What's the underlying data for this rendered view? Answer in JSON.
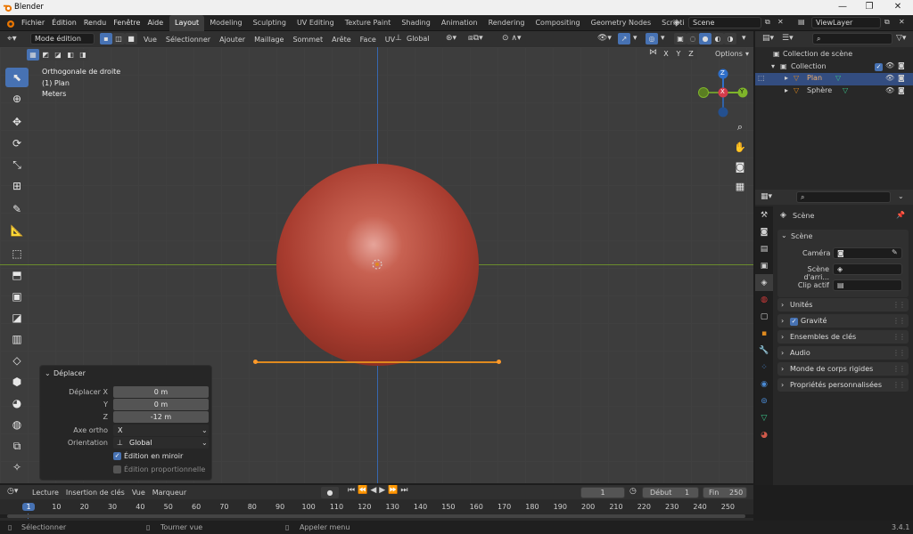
{
  "window": {
    "title": "Blender",
    "minimize": "—",
    "maximize": "❐",
    "close": "✕"
  },
  "menu": [
    "Fichier",
    "Édition",
    "Rendu",
    "Fenêtre",
    "Aide"
  ],
  "workspaces": [
    "Layout",
    "Modeling",
    "Sculpting",
    "UV Editing",
    "Texture Paint",
    "Shading",
    "Animation",
    "Rendering",
    "Compositing",
    "Geometry Nodes",
    "Scripting"
  ],
  "scene": {
    "name": "Scene",
    "viewlayer": "ViewLayer"
  },
  "header": {
    "mode": "Mode édition",
    "items": [
      "Vue",
      "Sélectionner",
      "Ajouter",
      "Maillage",
      "Sommet",
      "Arête",
      "Face",
      "UV"
    ],
    "orientation": "Global",
    "options": "Options",
    "axes": [
      "X",
      "Y",
      "Z"
    ]
  },
  "viewport": {
    "view_name": "Orthogonale de droite",
    "object": "(1) Plan",
    "units": "Meters",
    "gizmo": {
      "x": "X",
      "y": "Y",
      "z": "Z"
    }
  },
  "operator": {
    "title": "Déplacer",
    "move_label": "Déplacer X",
    "x": "0 m",
    "y_label": "Y",
    "y": "0 m",
    "z_label": "Z",
    "z": "-12 m",
    "axis_label": "Axe ortho",
    "axis": "X",
    "orient_label": "Orientation",
    "orient": "Global",
    "mirror": "Édition en miroir",
    "proportional": "Édition proportionnelle"
  },
  "outliner": {
    "root": "Collection de scène",
    "collection": "Collection",
    "items": [
      {
        "name": "Plan"
      },
      {
        "name": "Sphère"
      }
    ]
  },
  "properties": {
    "context": "Scène",
    "section": "Scène",
    "camera_label": "Caméra",
    "background_label": "Scène d'arri...",
    "clip_label": "Clip actif",
    "panels": [
      "Unités",
      "Gravité",
      "Ensembles de clés",
      "Audio",
      "Monde de corps rigides",
      "Propriétés personnalisées"
    ]
  },
  "timeline": {
    "menus": [
      "Lecture",
      "Insertion de clés",
      "Vue",
      "Marqueur"
    ],
    "current_frame": "1",
    "start_label": "Début",
    "start": "1",
    "end_label": "Fin",
    "end": "250",
    "ticks": [
      "1",
      "10",
      "20",
      "30",
      "40",
      "50",
      "60",
      "70",
      "80",
      "90",
      "100",
      "110",
      "120",
      "130",
      "140",
      "150",
      "160",
      "170",
      "180",
      "190",
      "200",
      "210",
      "220",
      "230",
      "240",
      "250"
    ]
  },
  "status": {
    "select": "Sélectionner",
    "rotate": "Tourner vue",
    "menu": "Appeler menu",
    "version": "3.4.1"
  },
  "colors": {
    "accent": "#4772b3",
    "sphere": "#b44a3c",
    "edge": "#e08a1e",
    "x_axis": "#d63b4b",
    "y_axis": "#7fb52a",
    "z_axis": "#2f6fc9"
  }
}
